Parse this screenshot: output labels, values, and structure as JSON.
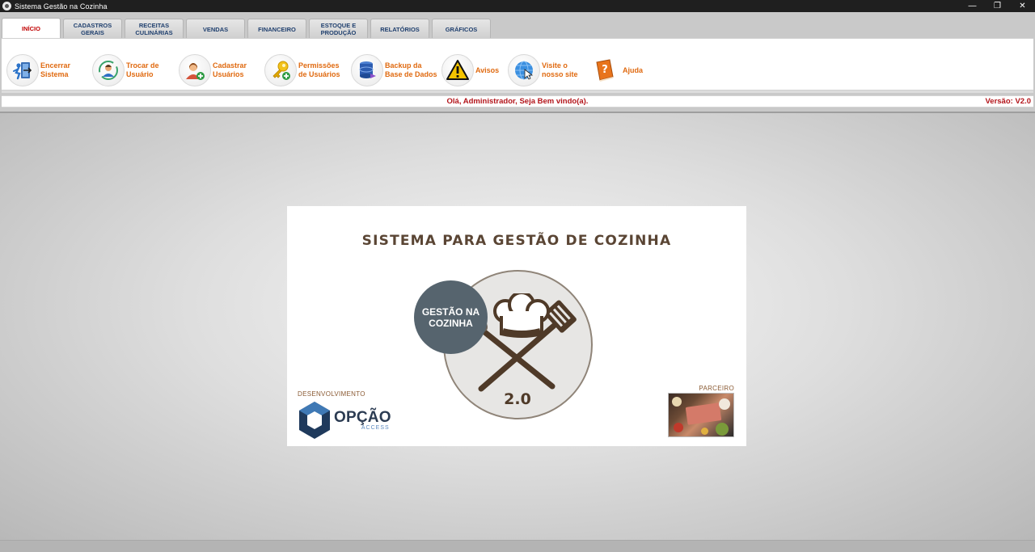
{
  "window": {
    "title": "Sistema Gestão na Cozinha",
    "minimize": "—",
    "maximize": "❐",
    "close": "✕"
  },
  "tabs": [
    {
      "label": "INÍCIO",
      "active": true
    },
    {
      "label": "CADASTROS GERAIS",
      "active": false
    },
    {
      "label": "RECEITAS CULINÁRIAS",
      "active": false
    },
    {
      "label": "VENDAS",
      "active": false
    },
    {
      "label": "FINANCEIRO",
      "active": false
    },
    {
      "label": "ESTOQUE E PRODUÇÃO",
      "active": false
    },
    {
      "label": "RELATÓRIOS",
      "active": false
    },
    {
      "label": "GRÁFICOS",
      "active": false
    }
  ],
  "tools": [
    {
      "label": "Encerrar\nSistema",
      "icon": "exit-door-icon"
    },
    {
      "label": "Trocar de\nUsuário",
      "icon": "switch-user-icon"
    },
    {
      "label": "Cadastrar\nUsuários",
      "icon": "add-user-icon"
    },
    {
      "label": "Permissões\nde Usuários",
      "icon": "key-permission-icon"
    },
    {
      "label": "Backup da\nBase de Dados",
      "icon": "database-backup-icon"
    },
    {
      "label": "Avisos",
      "icon": "warning-icon"
    },
    {
      "label": "Visite o\nnosso site",
      "icon": "globe-icon"
    },
    {
      "label": "Ajuda",
      "icon": "help-book-icon"
    }
  ],
  "status": {
    "welcome": "Olá, Administrador, Seja Bem vindo(a).",
    "version": "Versão: V2.0"
  },
  "splash": {
    "title": "SISTEMA PARA GESTÃO DE COZINHA",
    "badge": "GESTÃO NA\nCOZINHA",
    "version": "2.0",
    "developer_label": "DESENVOLVIMENTO",
    "developer_name": "OPÇÃO",
    "developer_sub": "ACCESS",
    "partner_label": "PARCEIRO"
  },
  "colors": {
    "accent_orange": "#e06a10",
    "alert_red": "#b3141a",
    "tab_blue": "#1f3f6e",
    "badge_slate": "#56646e",
    "brown": "#5a4534"
  }
}
